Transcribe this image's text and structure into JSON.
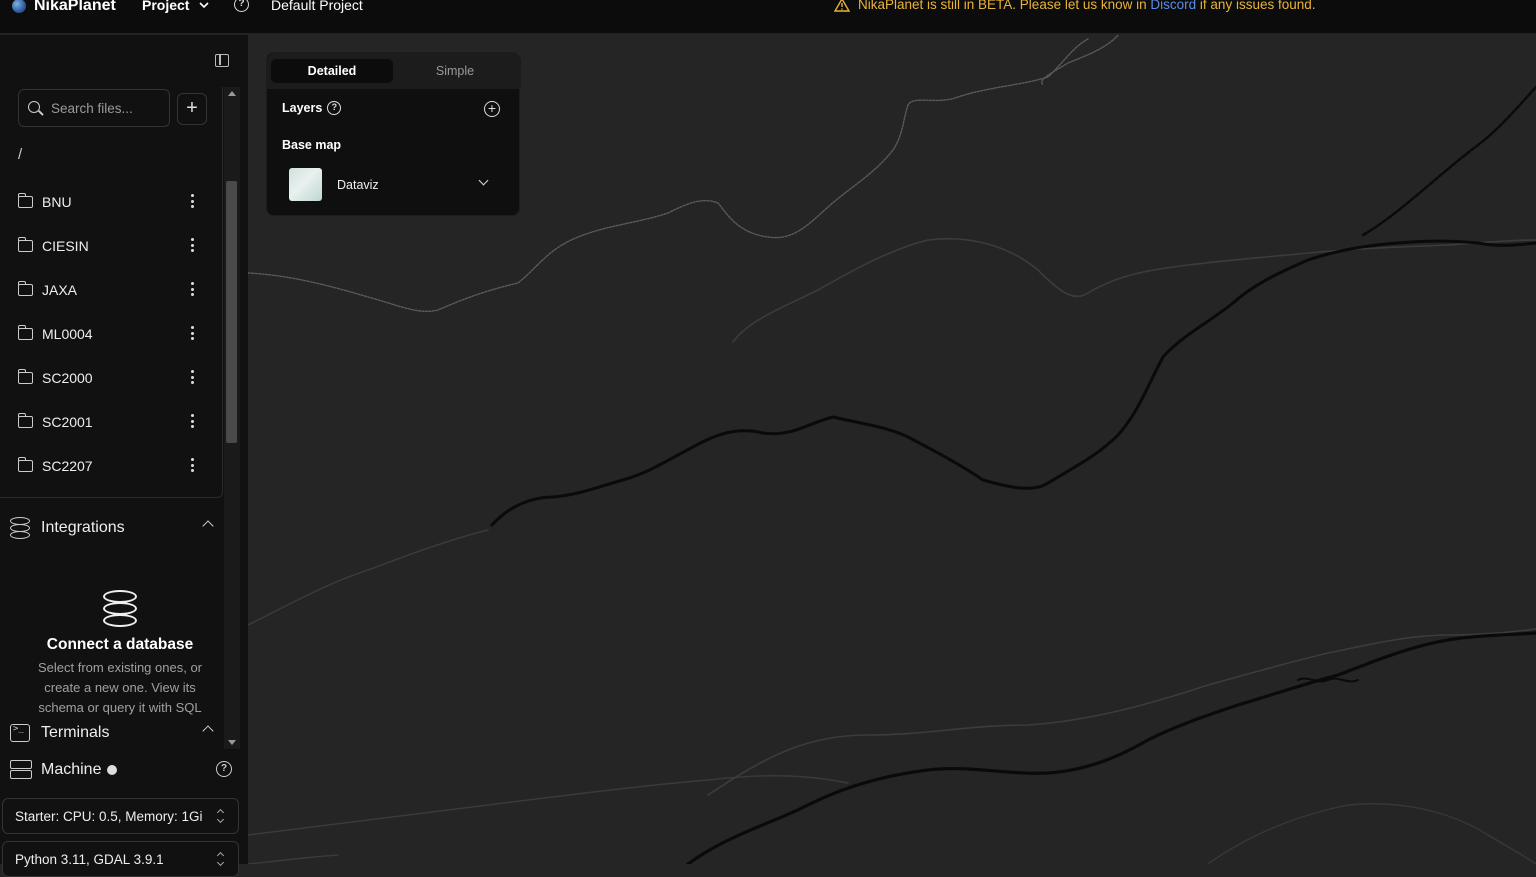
{
  "header": {
    "brand": "NikaPlanet",
    "project_menu": "Project",
    "project_name": "Default Project",
    "beta_prefix": "NikaPlanet is still in BETA. Please let us know in",
    "beta_link": "Discord",
    "beta_suffix": "if any issues found."
  },
  "files": {
    "search_placeholder": "Search files...",
    "root": "/",
    "folders": [
      "BNU",
      "CIESIN",
      "JAXA",
      "ML0004",
      "SC2000",
      "SC2001",
      "SC2207"
    ]
  },
  "integrations": {
    "title": "Integrations",
    "connect_title": "Connect a database",
    "connect_desc": "Select from existing ones, or create a new one. View its schema or query it with SQL"
  },
  "terminals": {
    "title": "Terminals"
  },
  "machine": {
    "title": "Machine",
    "tier": "Starter: CPU: 0.5, Memory: 1Gi",
    "env": "Python 3.11, GDAL 3.9.1"
  },
  "layers_panel": {
    "tabs": [
      "Detailed",
      "Simple"
    ],
    "layers_label": "Layers",
    "basemap_label": "Base map",
    "basemap_value": "Dataviz"
  },
  "colors": {
    "warning": "#e9b33a",
    "link": "#5a8ee8",
    "map_bg": "#252525"
  }
}
